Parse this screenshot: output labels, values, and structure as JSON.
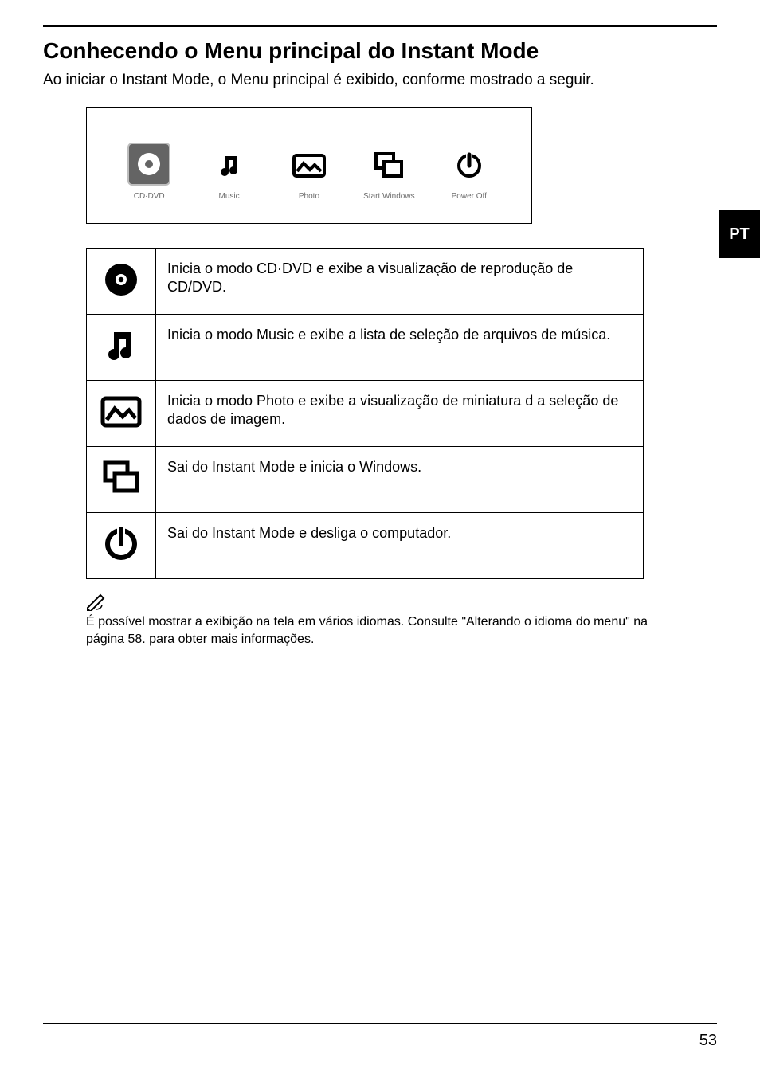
{
  "title": "Conhecendo o Menu principal do Instant Mode",
  "intro": "Ao iniciar o Instant Mode, o Menu principal é exibido, conforme mostrado a seguir.",
  "diagram": {
    "items": [
      {
        "label": "CD·DVD"
      },
      {
        "label": "Music"
      },
      {
        "label": "Photo"
      },
      {
        "label": "Start Windows"
      },
      {
        "label": "Power Off"
      }
    ]
  },
  "features": [
    {
      "desc": "Inicia o modo CD·DVD e exibe a visualização de reprodução de CD/DVD."
    },
    {
      "desc": "Inicia o modo Music e exibe a lista de seleção de arquivos de música."
    },
    {
      "desc": "Inicia o modo Photo e exibe a visualização de miniatura d a seleção de dados de imagem."
    },
    {
      "desc": "Sai do Instant Mode e inicia o Windows."
    },
    {
      "desc": "Sai do Instant Mode e desliga o computador."
    }
  ],
  "footnote": "É possível mostrar a exibição na tela em vários idiomas. Consulte \"Alterando o idioma do menu\" na página 58. para obter mais informações.",
  "side_tab": "PT",
  "page_number": "53"
}
